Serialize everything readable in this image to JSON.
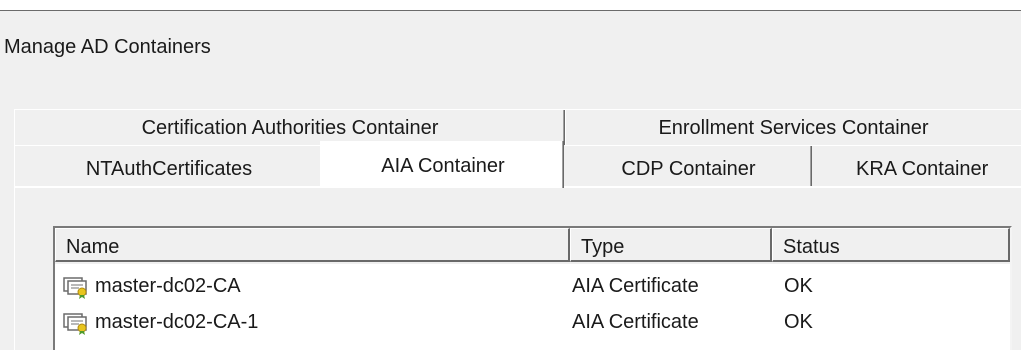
{
  "dialog": {
    "title": "Manage AD Containers"
  },
  "tabs": {
    "row1": [
      {
        "label": "Certification Authorities Container"
      },
      {
        "label": "Enrollment Services Container"
      }
    ],
    "row2": [
      {
        "label": "NTAuthCertificates"
      },
      {
        "label": "AIA Container",
        "active": true
      },
      {
        "label": "CDP Container"
      },
      {
        "label": "KRA Container"
      }
    ]
  },
  "list": {
    "columns": [
      "Name",
      "Type",
      "Status"
    ],
    "rows": [
      {
        "name": "master-dc02-CA",
        "type": "AIA Certificate",
        "status": "OK",
        "icon": "certificate-icon"
      },
      {
        "name": "master-dc02-CA-1",
        "type": "AIA Certificate",
        "status": "OK",
        "icon": "certificate-icon"
      }
    ]
  },
  "colors": {
    "window_bg": "#f0f0f0",
    "list_bg": "#ffffff",
    "icon_yellow": "#e8c51e",
    "icon_green": "#4f9a2c"
  }
}
